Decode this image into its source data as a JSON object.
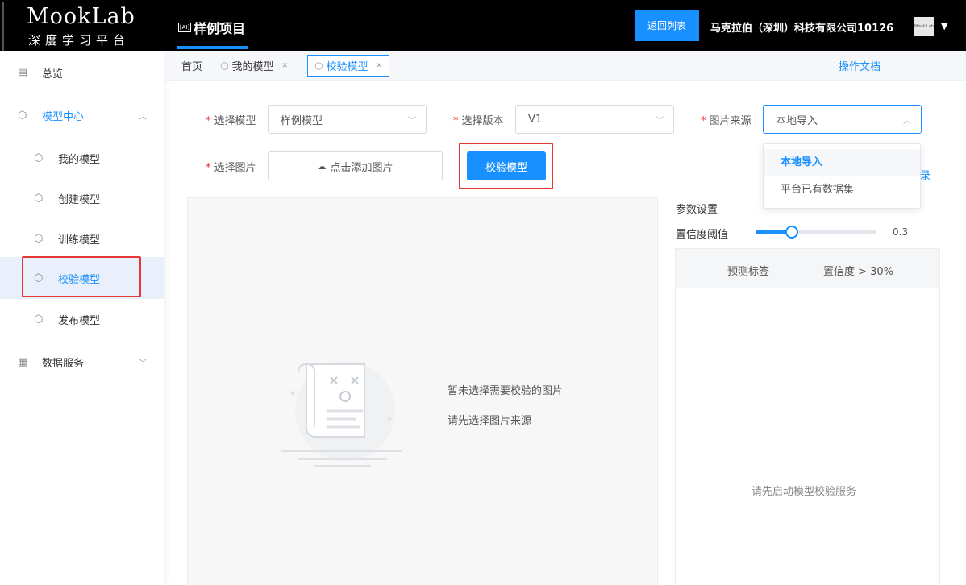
{
  "header": {
    "logo_main": "MookLab",
    "logo_sub": "深度学习平台",
    "project_icon": "[AI]",
    "project_title": "样例项目",
    "back_button": "返回列表",
    "company": "马克拉伯（深圳）科技有限公司10126",
    "avatar_text": "Mook Lab"
  },
  "sidebar": {
    "overview": "总览",
    "model_center": "模型中心",
    "items": [
      {
        "label": "我的模型"
      },
      {
        "label": "创建模型"
      },
      {
        "label": "训练模型"
      },
      {
        "label": "校验模型"
      },
      {
        "label": "发布模型"
      }
    ],
    "data_service": "数据服务"
  },
  "tabs": [
    {
      "label": "首页"
    },
    {
      "label": "我的模型"
    },
    {
      "label": "校验模型"
    }
  ],
  "docs_link": "操作文档",
  "form": {
    "model_label": "选择模型",
    "model_value": "样例模型",
    "version_label": "选择版本",
    "version_value": "V1",
    "source_label": "图片来源",
    "source_value": "本地导入",
    "image_label": "选择图片",
    "upload_button": "点击添加图片",
    "verify_button": "校验模型"
  },
  "source_dropdown": {
    "options": [
      "本地导入",
      "平台已有数据集"
    ],
    "selected": "本地导入"
  },
  "record_fragment": "录",
  "preview": {
    "empty_line1": "暂未选择需要校验的图片",
    "empty_line2": "请先选择图片来源"
  },
  "params": {
    "title": "参数设置",
    "confidence_label": "置信度阈值",
    "confidence_value": "0.3",
    "confidence_fraction": 0.3
  },
  "results": {
    "col_label": "预测标签",
    "col_conf": "置信度 > 30%",
    "empty": "请先启动模型校验服务"
  },
  "colors": {
    "accent": "#1890ff",
    "highlight_border": "#e53935",
    "topbar": "#000000"
  }
}
